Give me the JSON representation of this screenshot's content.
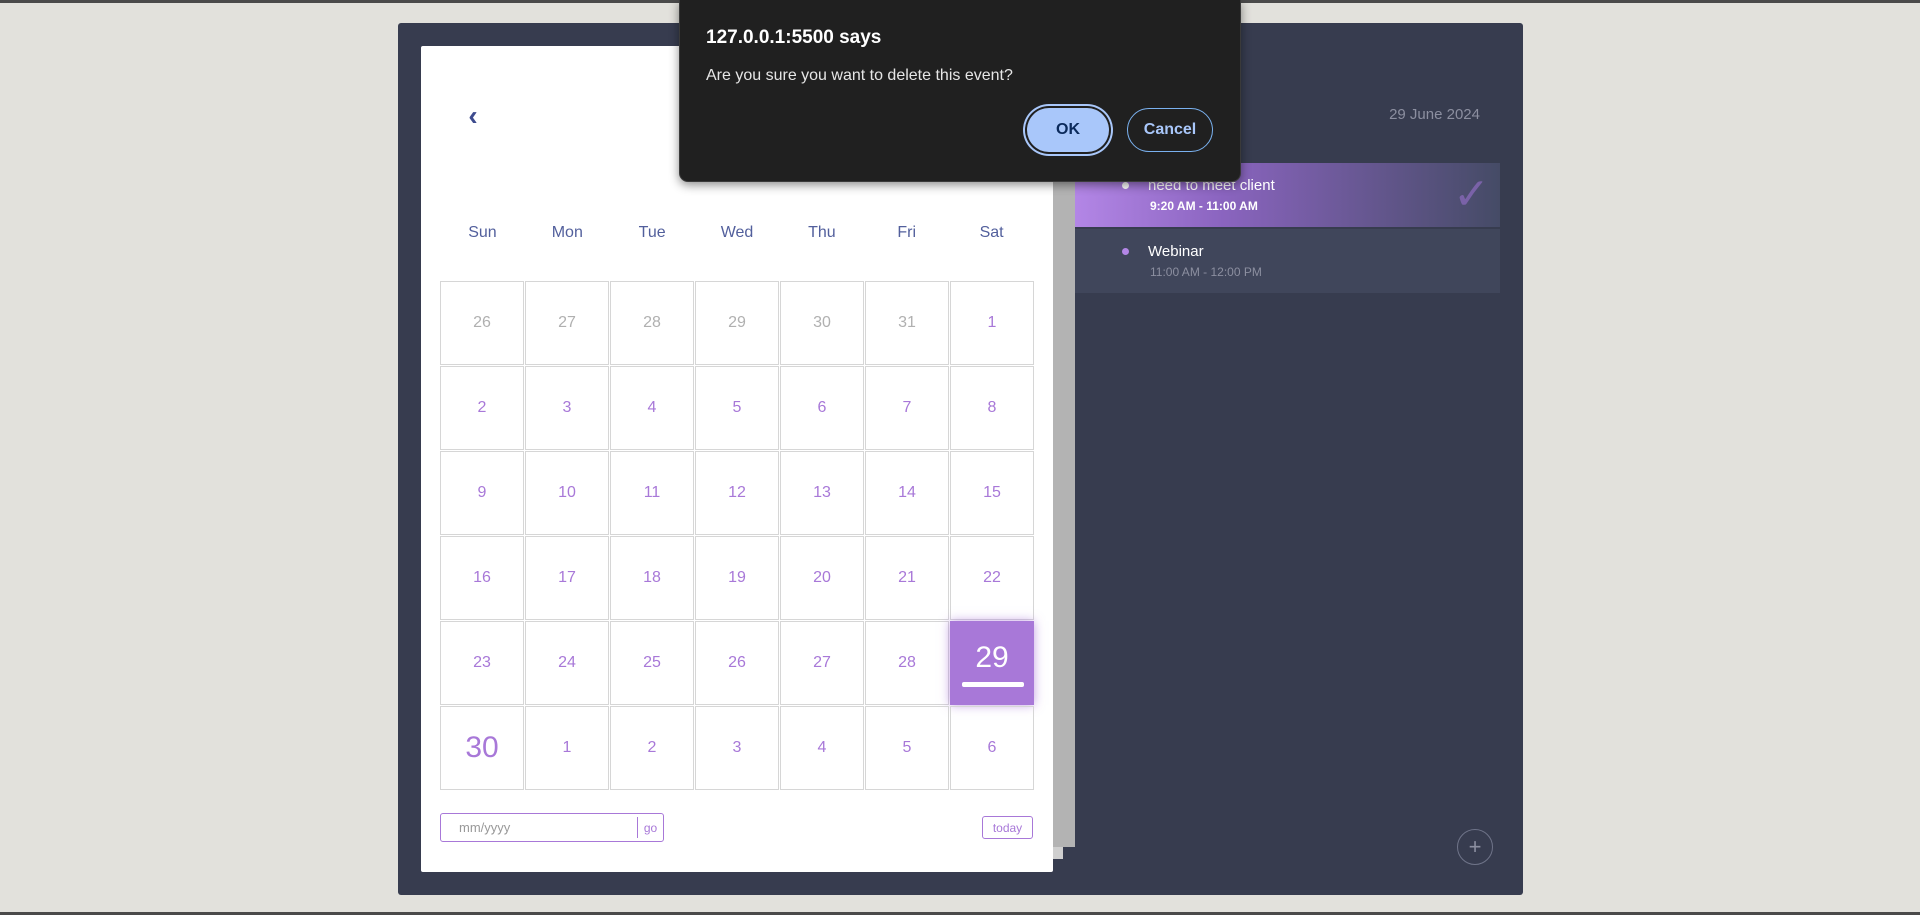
{
  "calendar": {
    "weekdays": [
      "Sun",
      "Mon",
      "Tue",
      "Wed",
      "Thu",
      "Fri",
      "Sat"
    ],
    "days": [
      {
        "label": "26",
        "type": "other"
      },
      {
        "label": "27",
        "type": "other"
      },
      {
        "label": "28",
        "type": "other"
      },
      {
        "label": "29",
        "type": "other"
      },
      {
        "label": "30",
        "type": "other"
      },
      {
        "label": "31",
        "type": "other"
      },
      {
        "label": "1",
        "type": "current"
      },
      {
        "label": "2",
        "type": "current"
      },
      {
        "label": "3",
        "type": "current"
      },
      {
        "label": "4",
        "type": "current"
      },
      {
        "label": "5",
        "type": "current"
      },
      {
        "label": "6",
        "type": "current"
      },
      {
        "label": "7",
        "type": "current"
      },
      {
        "label": "8",
        "type": "current"
      },
      {
        "label": "9",
        "type": "current"
      },
      {
        "label": "10",
        "type": "current"
      },
      {
        "label": "11",
        "type": "current"
      },
      {
        "label": "12",
        "type": "current"
      },
      {
        "label": "13",
        "type": "current"
      },
      {
        "label": "14",
        "type": "current"
      },
      {
        "label": "15",
        "type": "current"
      },
      {
        "label": "16",
        "type": "current"
      },
      {
        "label": "17",
        "type": "current"
      },
      {
        "label": "18",
        "type": "current"
      },
      {
        "label": "19",
        "type": "current"
      },
      {
        "label": "20",
        "type": "current"
      },
      {
        "label": "21",
        "type": "current"
      },
      {
        "label": "22",
        "type": "current"
      },
      {
        "label": "23",
        "type": "current"
      },
      {
        "label": "24",
        "type": "current"
      },
      {
        "label": "25",
        "type": "current"
      },
      {
        "label": "26",
        "type": "current"
      },
      {
        "label": "27",
        "type": "current"
      },
      {
        "label": "28",
        "type": "current"
      },
      {
        "label": "29",
        "type": "selected"
      },
      {
        "label": "30",
        "type": "big"
      },
      {
        "label": "1",
        "type": "next"
      },
      {
        "label": "2",
        "type": "next"
      },
      {
        "label": "3",
        "type": "next"
      },
      {
        "label": "4",
        "type": "next"
      },
      {
        "label": "5",
        "type": "next"
      },
      {
        "label": "6",
        "type": "next"
      }
    ],
    "goto_placeholder": "mm/yyyy",
    "go_label": "go",
    "today_label": "today",
    "prev_icon": "chevron-left-icon"
  },
  "events_panel": {
    "date": "29 June 2024",
    "events": [
      {
        "title": "need to meet client",
        "time": "9:20 AM - 11:00 AM"
      },
      {
        "title": "Webinar",
        "time": "11:00 AM - 12:00 PM"
      }
    ],
    "check_icon": "check-icon",
    "add_icon": "plus-icon"
  },
  "dialog": {
    "title": "127.0.0.1:5500 says",
    "message": "Are you sure you want to delete this event?",
    "ok_label": "OK",
    "cancel_label": "Cancel"
  },
  "colors": {
    "page_bg": "#e2e1dc",
    "container_bg": "#373c4f",
    "accent": "#a878d8",
    "weekday_text": "#525f9c",
    "dialog_bg": "#202020",
    "dialog_ok_bg": "#a9c7fa"
  }
}
